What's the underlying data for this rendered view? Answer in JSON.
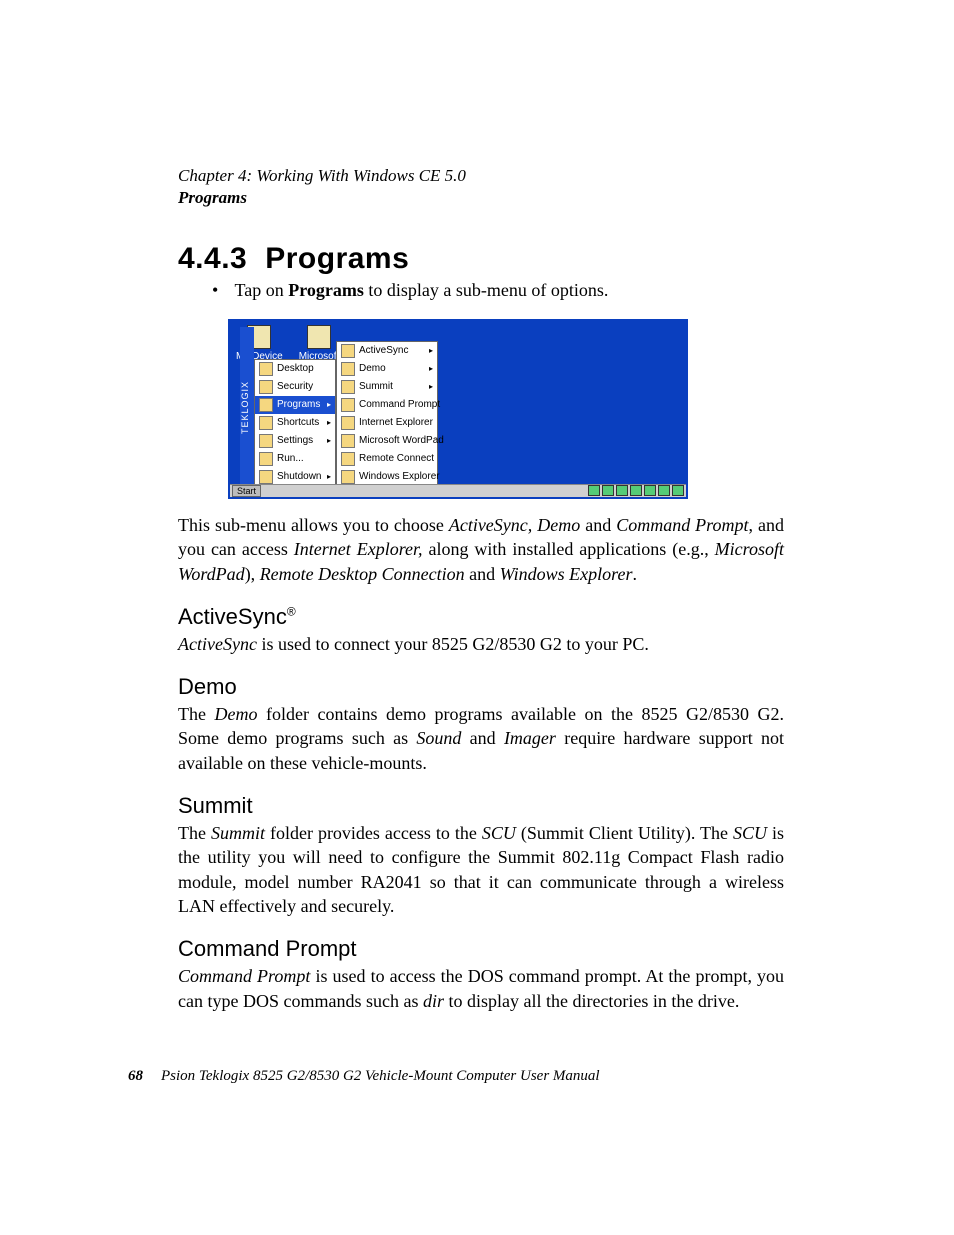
{
  "header": {
    "chapter": "Chapter 4: Working With Windows CE 5.0",
    "section": "Programs"
  },
  "section": {
    "number": "4.4.3",
    "title": "Programs",
    "bullet": {
      "pre": "Tap on ",
      "bold": "Programs",
      "post": " to display a sub-menu of options."
    }
  },
  "screenshot": {
    "desktop_icons": [
      "My Device",
      "Microsoft"
    ],
    "vstrip": "TEKLOGIX",
    "start_menu": [
      {
        "label": "Desktop",
        "arrow": false,
        "sel": false
      },
      {
        "label": "Security",
        "arrow": false,
        "sel": false
      },
      {
        "label": "Programs",
        "arrow": true,
        "sel": true
      },
      {
        "label": "Shortcuts",
        "arrow": true,
        "sel": false
      },
      {
        "label": "Settings",
        "arrow": true,
        "sel": false
      },
      {
        "label": "Run...",
        "arrow": false,
        "sel": false
      },
      {
        "label": "Shutdown",
        "arrow": true,
        "sel": false
      }
    ],
    "sub_menu": [
      {
        "label": "ActiveSync",
        "arrow": true
      },
      {
        "label": "Demo",
        "arrow": true
      },
      {
        "label": "Summit",
        "arrow": true
      },
      {
        "label": "Command Prompt",
        "arrow": false
      },
      {
        "label": "Internet Explorer",
        "arrow": false
      },
      {
        "label": "Microsoft WordPad",
        "arrow": false
      },
      {
        "label": "Remote Connect",
        "arrow": false
      },
      {
        "label": "Windows Explorer",
        "arrow": false
      }
    ],
    "start_label": "Start"
  },
  "para1": {
    "t1": "This sub-menu allows you to choose ",
    "i1": "ActiveSync, Demo",
    "t2": " and ",
    "i2": "Command Prompt",
    "t3": ", and you can access ",
    "i3": "Internet Explorer,",
    "t4": " along with installed applications (e.g., ",
    "i4": "Microsoft WordPad",
    "t5": "), ",
    "i5": "Remote Desktop Connection",
    "t6": " and ",
    "i6": "Windows Explorer",
    "t7": "."
  },
  "activesync": {
    "heading": "ActiveSync",
    "reg": "®",
    "i1": "ActiveSync",
    "t1": " is used to connect your 8525 G2/8530 G2 to your PC."
  },
  "demo": {
    "heading": "Demo",
    "t1": "The ",
    "i1": "Demo",
    "t2": " folder contains demo programs available on the 8525 G2/8530 G2. Some demo programs such as ",
    "i2": "Sound",
    "t3": " and ",
    "i3": "Imager",
    "t4": " require hardware support not available on these vehicle-mounts."
  },
  "summit": {
    "heading": "Summit",
    "t1": "The ",
    "i1": "Summit",
    "t2": " folder provides access to the ",
    "i2": "SCU",
    "t3": " (Summit Client Utility). The ",
    "i3": "SCU",
    "t4": " is the utility you will need to configure the Summit 802.11g Compact Flash radio module, model number RA2041 so that it can communicate through a wireless LAN effectively and securely."
  },
  "cmd": {
    "heading": "Command Prompt",
    "i1": "Command Prompt",
    "t1": " is used to access the DOS command prompt. At the prompt, you can type DOS commands such as ",
    "i2": "dir",
    "t2": " to display all the directories in the drive."
  },
  "footer": {
    "page_number": "68",
    "title": "Psion Teklogix 8525 G2/8530 G2 Vehicle-Mount Computer User Manual"
  }
}
